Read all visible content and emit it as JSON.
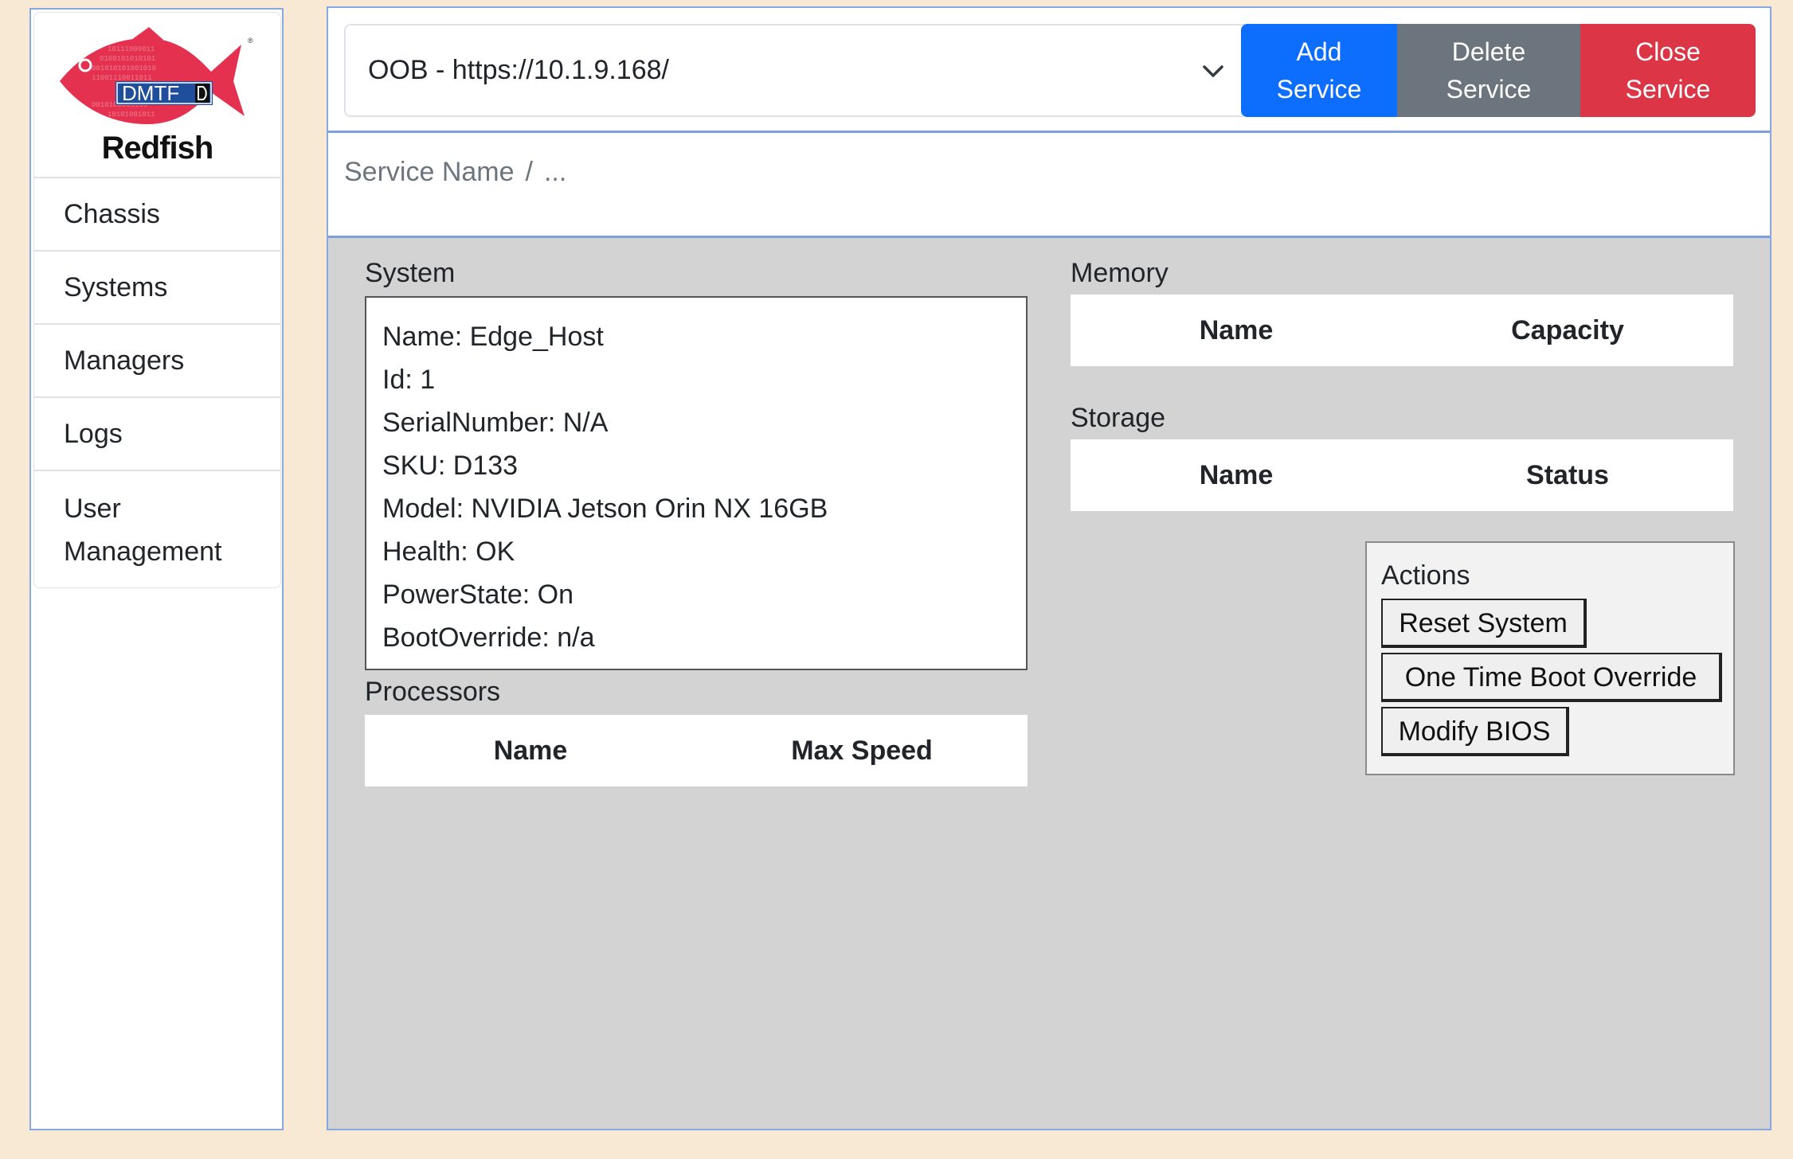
{
  "sidebar": {
    "logo": {
      "badge_text": "DMTF",
      "wordmark": "Redfish"
    },
    "items": [
      {
        "label": "Chassis"
      },
      {
        "label": "Systems"
      },
      {
        "label": "Managers"
      },
      {
        "label": "Logs"
      },
      {
        "label": "User Management"
      }
    ]
  },
  "topbar": {
    "service_select": {
      "value": "OOB - https://10.1.9.168/",
      "icon": "chevron-down-icon"
    },
    "buttons": {
      "add_line1": "Add",
      "add_line2": "Service",
      "delete_line1": "Delete",
      "delete_line2": "Service",
      "close_line1": "Close",
      "close_line2": "Service"
    }
  },
  "breadcrumb": {
    "root": "Service Name",
    "separator": "/",
    "current": "..."
  },
  "system": {
    "label": "System",
    "lines": [
      "Name: Edge_Host",
      "Id: 1",
      "SerialNumber: N/A",
      "SKU: D133",
      "Model: NVIDIA Jetson Orin NX 16GB",
      "Health: OK",
      "PowerState: On",
      "BootOverride: n/a"
    ]
  },
  "processors": {
    "label": "Processors",
    "columns": [
      "Name",
      "Max Speed"
    ]
  },
  "memory": {
    "label": "Memory",
    "columns": [
      "Name",
      "Capacity"
    ]
  },
  "storage": {
    "label": "Storage",
    "columns": [
      "Name",
      "Status"
    ]
  },
  "actions": {
    "title": "Actions",
    "buttons": [
      "Reset System",
      "One Time Boot Override",
      "Modify BIOS"
    ]
  },
  "colors": {
    "page_bg": "#f8e9d4",
    "panel_bg": "#d3d3d3",
    "primary": "#0d6efd",
    "secondary": "#6c757d",
    "danger": "#dc3545",
    "logo_red": "#e4314f",
    "logo_blue": "#1f4e9c"
  }
}
